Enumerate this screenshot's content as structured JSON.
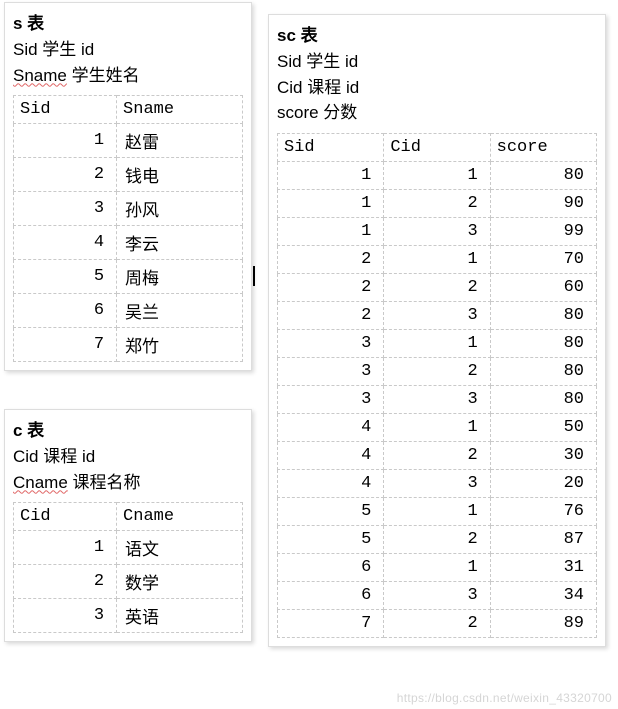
{
  "s": {
    "title": "s 表",
    "desc1_a": "Sid",
    "desc1_b": " 学生 id",
    "desc2_a": "Sname",
    "desc2_b": "  学生姓名",
    "cols": [
      "Sid",
      "Sname"
    ],
    "rows": [
      [
        1,
        "赵雷"
      ],
      [
        2,
        "钱电"
      ],
      [
        3,
        "孙风"
      ],
      [
        4,
        "李云"
      ],
      [
        5,
        "周梅"
      ],
      [
        6,
        "吴兰"
      ],
      [
        7,
        "郑竹"
      ]
    ]
  },
  "c": {
    "title": "c 表",
    "desc1_a": "Cid",
    "desc1_b": " 课程 id",
    "desc2_a": "Cname",
    "desc2_b": "  课程名称",
    "cols": [
      "Cid",
      "Cname"
    ],
    "rows": [
      [
        1,
        "语文"
      ],
      [
        2,
        "数学"
      ],
      [
        3,
        "英语"
      ]
    ]
  },
  "sc": {
    "title": "sc 表",
    "desc1_a": "Sid",
    "desc1_b": " 学生 id",
    "desc2_a": "Cid",
    "desc2_b": " 课程 id",
    "desc3_a": "score",
    "desc3_b": " 分数",
    "cols": [
      "Sid",
      "Cid",
      "score"
    ],
    "rows": [
      [
        1,
        1,
        80
      ],
      [
        1,
        2,
        90
      ],
      [
        1,
        3,
        99
      ],
      [
        2,
        1,
        70
      ],
      [
        2,
        2,
        60
      ],
      [
        2,
        3,
        80
      ],
      [
        3,
        1,
        80
      ],
      [
        3,
        2,
        80
      ],
      [
        3,
        3,
        80
      ],
      [
        4,
        1,
        50
      ],
      [
        4,
        2,
        30
      ],
      [
        4,
        3,
        20
      ],
      [
        5,
        1,
        76
      ],
      [
        5,
        2,
        87
      ],
      [
        6,
        1,
        31
      ],
      [
        6,
        3,
        34
      ],
      [
        7,
        2,
        89
      ]
    ]
  },
  "watermark": "https://blog.csdn.net/weixin_43320700"
}
